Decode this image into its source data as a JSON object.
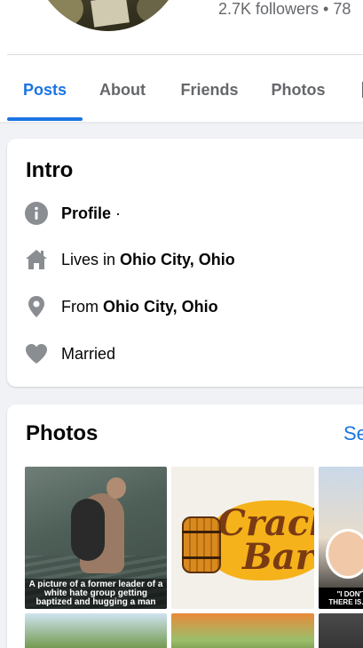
{
  "profile": {
    "followers_text": "2.7K followers • 78"
  },
  "tabs": [
    {
      "label": "Posts",
      "active": true
    },
    {
      "label": "About"
    },
    {
      "label": "Friends"
    },
    {
      "label": "Photos"
    }
  ],
  "intro": {
    "title": "Intro",
    "rows": [
      {
        "icon": "info-icon",
        "prefix": "Profile",
        "suffix": " ·"
      },
      {
        "icon": "home-icon",
        "prefix": "Lives in ",
        "value": "Ohio City, Ohio"
      },
      {
        "icon": "location-pin-icon",
        "prefix": "From ",
        "value": "Ohio City, Ohio"
      },
      {
        "icon": "heart-icon",
        "prefix": "Married"
      }
    ]
  },
  "photos": {
    "title": "Photos",
    "see_all": "Se",
    "items": [
      {
        "caption": "A picture of a former leader of a white hate group getting baptized and hugging a man"
      },
      {
        "caption_line1": "Cracke",
        "caption_line2": "Barr"
      },
      {
        "caption": "\"I DON'T B... THERE IS... I'M"
      }
    ]
  },
  "colors": {
    "accent": "#1b74e4",
    "muted_text": "#65676b",
    "icon_gray": "#606770"
  }
}
